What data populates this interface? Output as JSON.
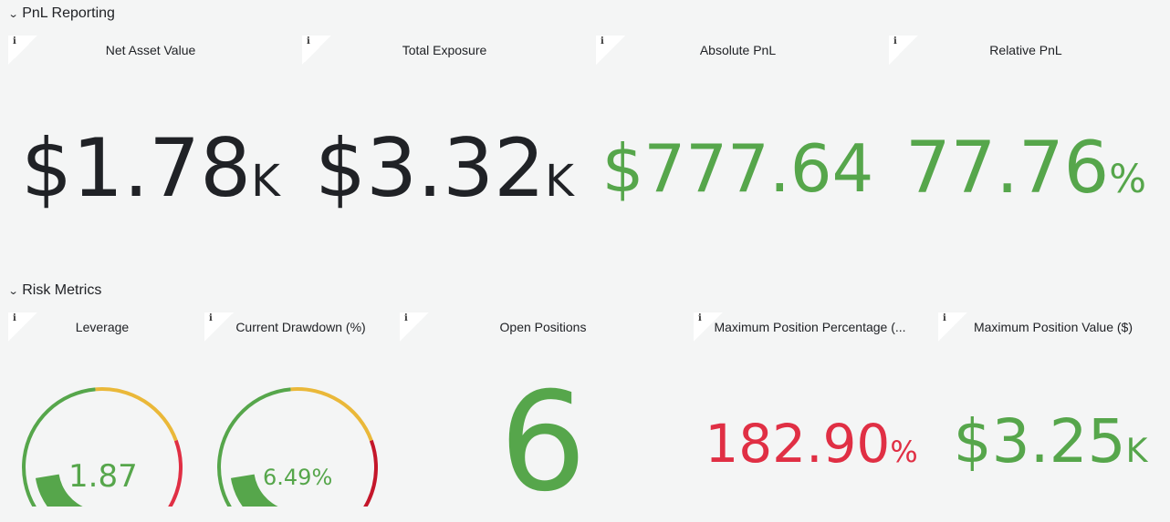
{
  "rows": {
    "pnl": {
      "title": "PnL Reporting",
      "chevron": "⌄"
    },
    "risk": {
      "title": "Risk Metrics",
      "chevron": "⌄"
    }
  },
  "info_glyph": "i",
  "pnl_panels": {
    "nav": {
      "title": "Net Asset Value",
      "value": "$1.78",
      "unit": "K"
    },
    "exposure": {
      "title": "Total Exposure",
      "value": "$3.32",
      "unit": "K"
    },
    "abs_pnl": {
      "title": "Absolute PnL",
      "value": "$777.64",
      "unit": ""
    },
    "rel_pnl": {
      "title": "Relative PnL",
      "value": "77.76",
      "unit": "%"
    }
  },
  "risk_panels": {
    "leverage": {
      "title": "Leverage",
      "value": "1.87",
      "fill_fraction": 0.19
    },
    "drawdown": {
      "title": "Current Drawdown (%)",
      "value": "6.49%",
      "fill_fraction": 0.19
    },
    "open_positions": {
      "title": "Open Positions",
      "value": "6"
    },
    "max_pos_pct": {
      "title": "Maximum Position Percentage (...",
      "value": "182.90",
      "unit": "%"
    },
    "max_pos_val": {
      "title": "Maximum Position Value ($)",
      "value": "$3.25",
      "unit": "K"
    }
  },
  "colors": {
    "green": "#56a64b",
    "yellow": "#eab839",
    "red": "#e02f44",
    "dark_red": "#c4162a",
    "text": "#202226",
    "background": "#f4f5f5"
  }
}
